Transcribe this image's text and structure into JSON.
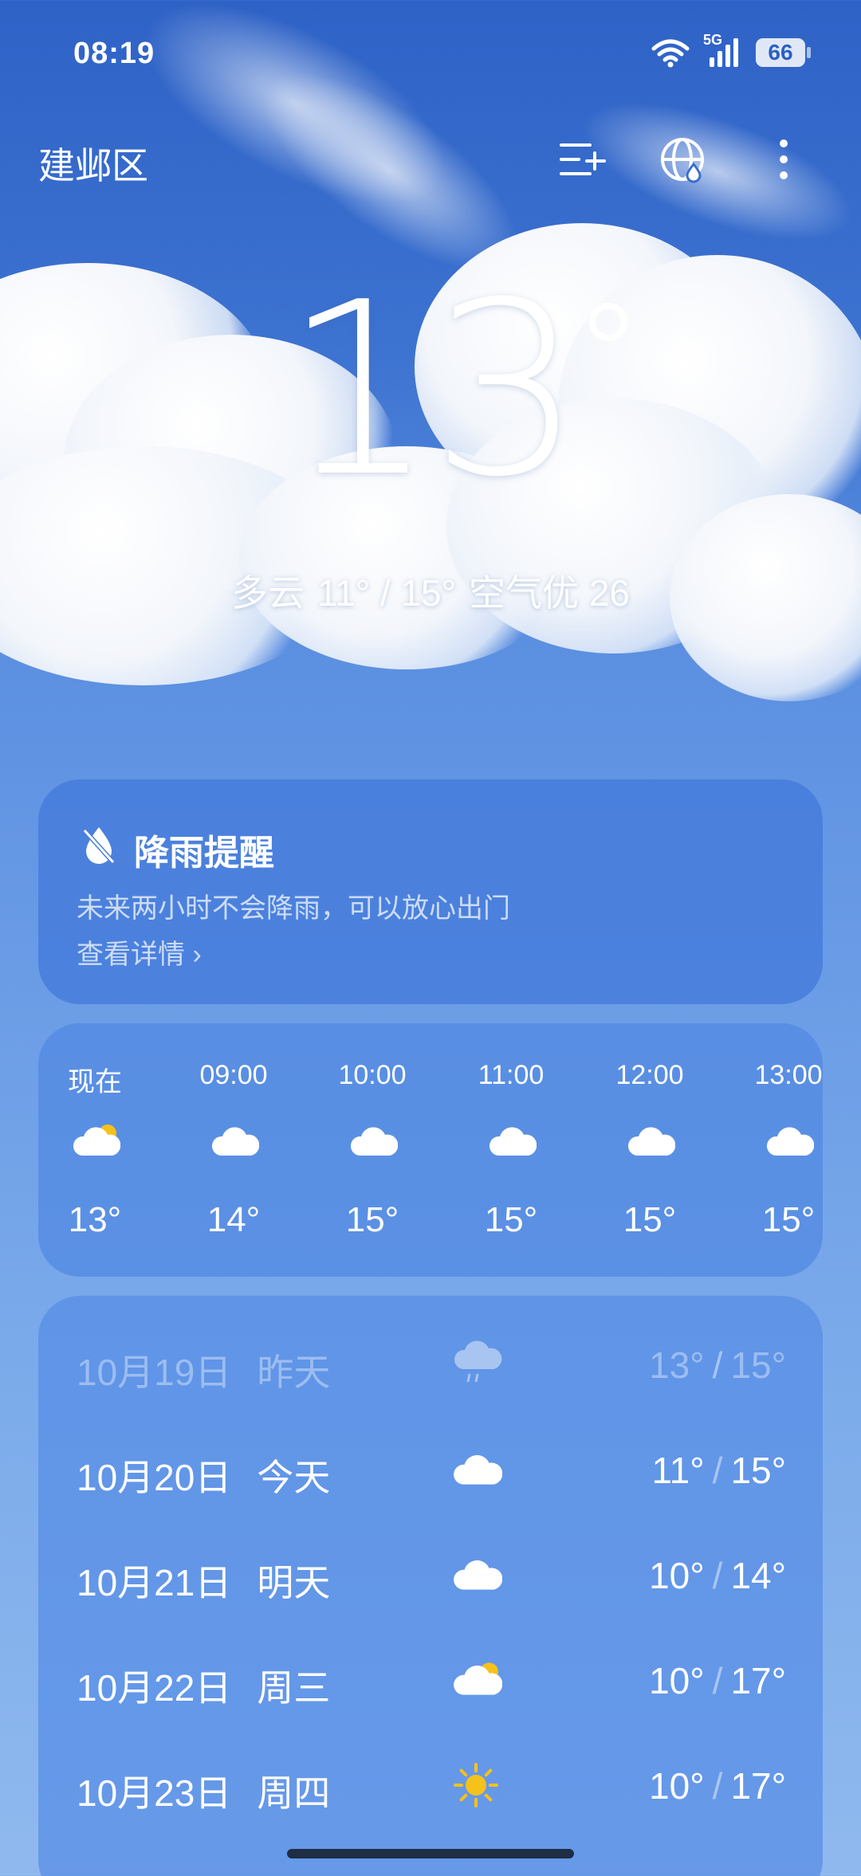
{
  "status_bar": {
    "time": "08:19",
    "network": "5G",
    "battery": "66"
  },
  "header": {
    "location": "建邺区",
    "icons": [
      "manage-cities-icon",
      "weather-globe-icon",
      "more-icon"
    ]
  },
  "current": {
    "temperature": "13",
    "condition": "多云",
    "range": "11° / 15°",
    "air_quality": "空气优 26"
  },
  "rain_alert": {
    "title": "降雨提醒",
    "description": "未来两小时不会降雨，可以放心出门",
    "link": "查看详情 ›"
  },
  "hourly": [
    {
      "time": "现在",
      "icon": "partly-cloudy-icon",
      "temp": "13°"
    },
    {
      "time": "09:00",
      "icon": "cloud-icon",
      "temp": "14°"
    },
    {
      "time": "10:00",
      "icon": "cloud-icon",
      "temp": "15°"
    },
    {
      "time": "11:00",
      "icon": "cloud-icon",
      "temp": "15°"
    },
    {
      "time": "12:00",
      "icon": "cloud-icon",
      "temp": "15°"
    },
    {
      "time": "13:00",
      "icon": "cloud-icon",
      "temp": "15°"
    }
  ],
  "daily": [
    {
      "date": "10月19日",
      "label": "昨天",
      "icon": "rain-cloud-icon",
      "low": "13°",
      "high": "15°",
      "past": true
    },
    {
      "date": "10月20日",
      "label": "今天",
      "icon": "cloud-icon",
      "low": "11°",
      "high": "15°"
    },
    {
      "date": "10月21日",
      "label": "明天",
      "icon": "cloud-icon",
      "low": "10°",
      "high": "14°"
    },
    {
      "date": "10月22日",
      "label": "周三",
      "icon": "partly-cloudy-icon",
      "low": "10°",
      "high": "17°"
    },
    {
      "date": "10月23日",
      "label": "周四",
      "icon": "sun-icon",
      "low": "10°",
      "high": "17°"
    }
  ],
  "colors": {
    "sky_top": "#2f62c6",
    "card": "#4f87e0",
    "sun": "#f5c21b"
  }
}
